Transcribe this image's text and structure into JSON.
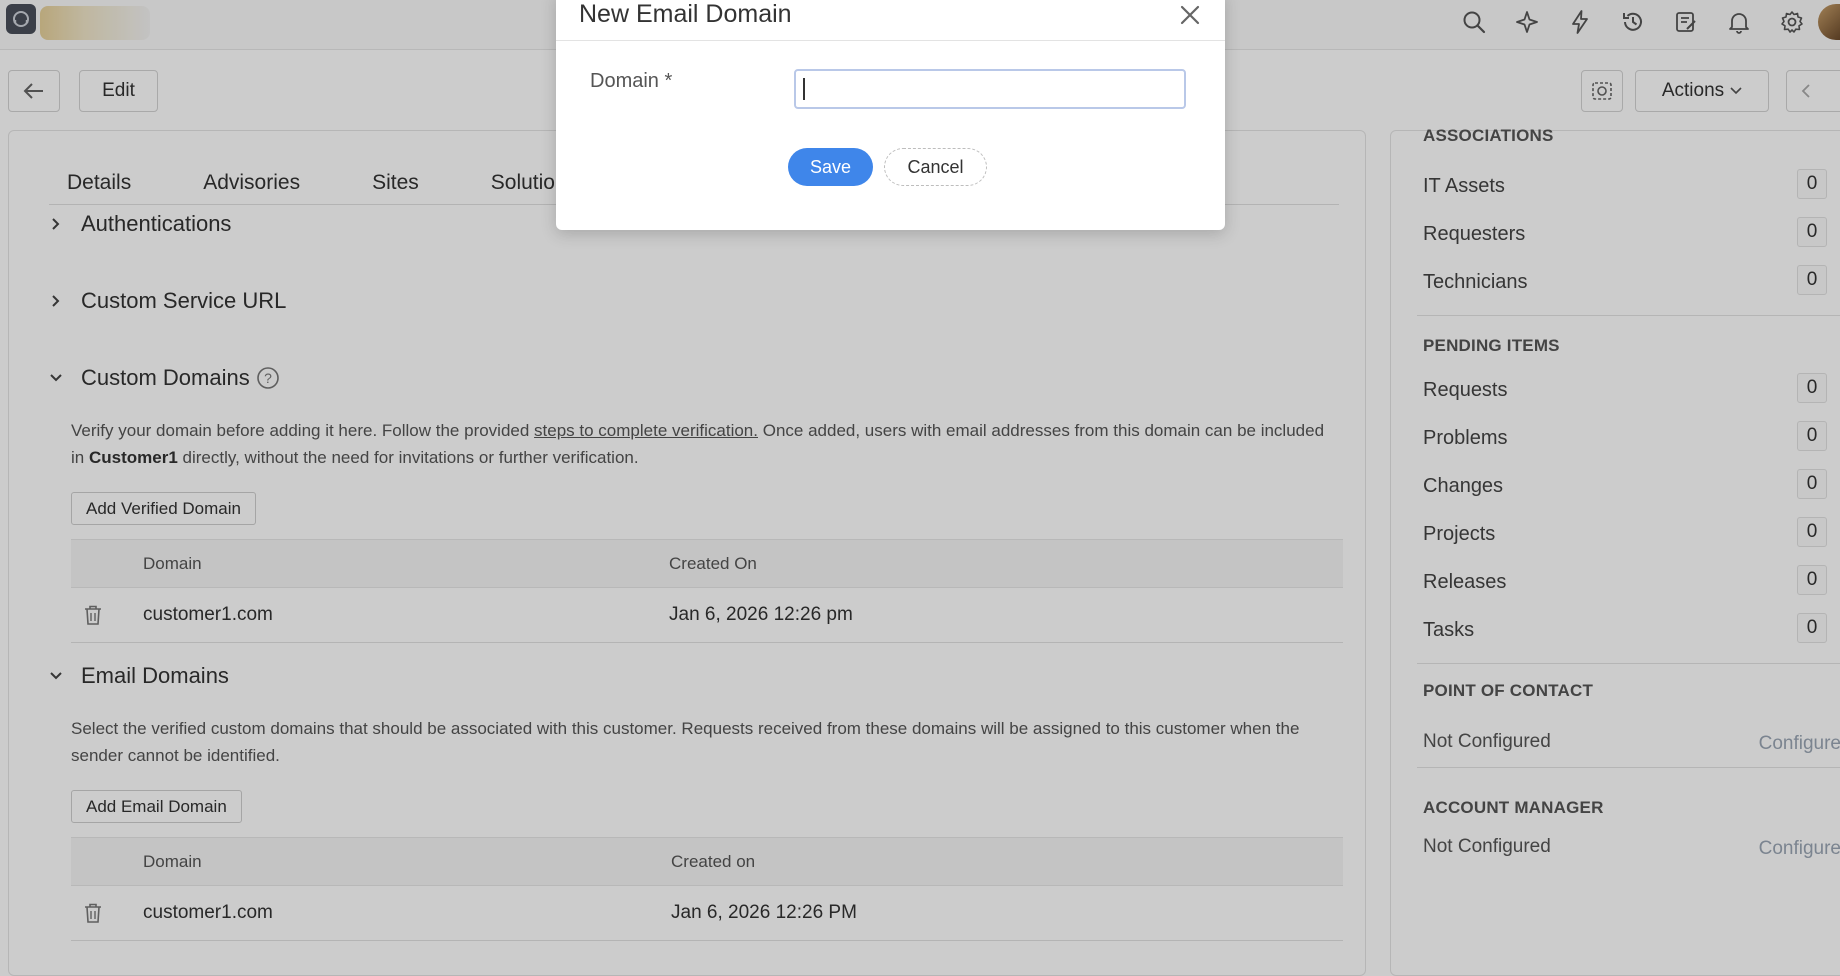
{
  "toolbar": {
    "edit_label": "Edit",
    "actions_label": "Actions"
  },
  "tabs": [
    "Details",
    "Advisories",
    "Sites",
    "Solutions"
  ],
  "sections": {
    "authentications": "Authentications",
    "custom_service_url": "Custom Service URL",
    "custom_domains": {
      "title": "Custom Domains",
      "desc_part1": "Verify your domain before adding it here. Follow the provided ",
      "desc_link": "steps to complete verification.",
      "desc_part2": " Once added, users with email addresses from this domain can be included in ",
      "desc_bold": "Customer1",
      "desc_part3": " directly, without the need for invitations or further verification.",
      "add_button": "Add Verified Domain",
      "col_domain": "Domain",
      "col_date": "Created On",
      "rows": [
        {
          "domain": "customer1.com",
          "created": "Jan 6, 2026 12:26 pm"
        }
      ]
    },
    "email_domains": {
      "title": "Email Domains",
      "desc": "Select the verified custom domains that should be associated with this customer. Requests received from these domains will be assigned to this customer when the sender cannot be identified.",
      "add_button": "Add Email Domain",
      "col_domain": "Domain",
      "col_date": "Created on",
      "rows": [
        {
          "domain": "customer1.com",
          "created": "Jan 6, 2026 12:26 PM"
        }
      ]
    }
  },
  "sidebar": {
    "associations_title": "ASSOCIATIONS",
    "associations": [
      {
        "label": "IT Assets",
        "count": "0"
      },
      {
        "label": "Requesters",
        "count": "0"
      },
      {
        "label": "Technicians",
        "count": "0"
      }
    ],
    "pending_title": "PENDING ITEMS",
    "pending": [
      {
        "label": "Requests",
        "count": "0"
      },
      {
        "label": "Problems",
        "count": "0"
      },
      {
        "label": "Changes",
        "count": "0"
      },
      {
        "label": "Projects",
        "count": "0"
      },
      {
        "label": "Releases",
        "count": "0"
      },
      {
        "label": "Tasks",
        "count": "0"
      }
    ],
    "poc_title": "POINT OF CONTACT",
    "poc_value": "Not Configured",
    "poc_link": "Configure",
    "am_title": "ACCOUNT MANAGER",
    "am_value": "Not Configured",
    "am_link": "Configure"
  },
  "modal": {
    "title": "New Email Domain",
    "field_label": "Domain *",
    "field_value": "",
    "save_label": "Save",
    "cancel_label": "Cancel"
  },
  "colors": {
    "primary": "#3f86ea",
    "link": "#9aa6b4"
  },
  "icons": [
    "search-icon",
    "ai-sparkle-icon",
    "lightning-icon",
    "history-icon",
    "notes-icon",
    "bell-icon",
    "gear-icon",
    "back-arrow-icon",
    "camera-icon",
    "chevron-down-icon",
    "chevron-left-icon",
    "chevron-right-icon",
    "help-icon",
    "trash-icon",
    "close-icon"
  ]
}
